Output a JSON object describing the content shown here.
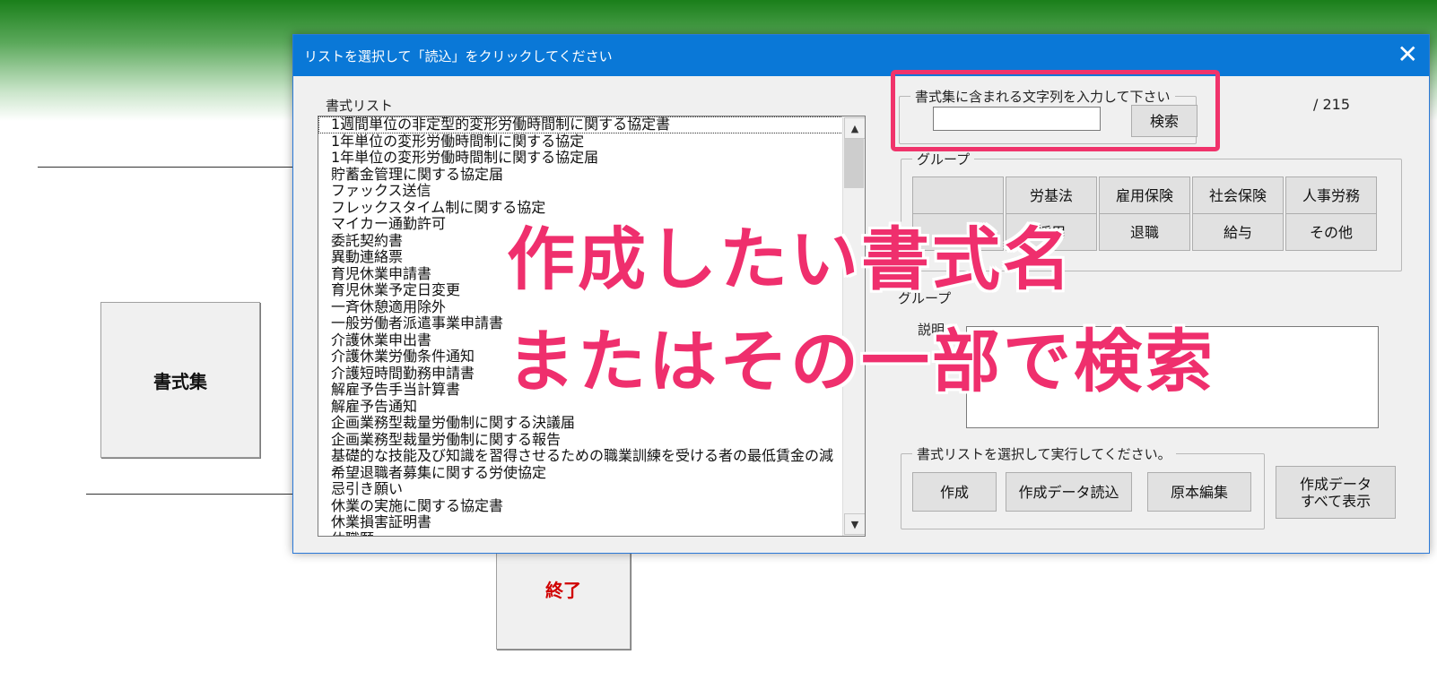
{
  "background": {
    "shosiki_button": "書式集",
    "exit_button": "終了"
  },
  "dialog": {
    "title": "リストを選択して「読込」をクリックしてください",
    "close_glyph": "✕",
    "list_label": "書式リスト",
    "list_items": [
      "1週間単位の非定型的変形労働時間制に関する協定書",
      "1年単位の変形労働時間制に関する協定",
      "1年単位の変形労働時間制に関する協定届",
      "貯蓄金管理に関する協定届",
      "ファックス送信",
      "フレックスタイム制に関する協定",
      "マイカー通勤許可",
      "委託契約書",
      "異動連絡票",
      "育児休業申請書",
      "育児休業予定日変更",
      "一斉休憩適用除外",
      "一般労働者派遣事業申請書",
      "介護休業申出書",
      "介護休業労働条件通知",
      "介護短時間勤務申請書",
      "解雇予告手当計算書",
      "解雇予告通知",
      "企画業務型裁量労働制に関する決議届",
      "企画業務型裁量労働制に関する報告",
      "基礎的な技能及び知識を習得させるための職業訓練を受ける者の最低賃金の減",
      "希望退職者募集に関する労使協定",
      "忌引き願い",
      "休業の実施に関する協定書",
      "休業損害証明書",
      "休職願"
    ],
    "search": {
      "group_title": "書式集に含まれる文字列を入力して下さい",
      "input_value": "",
      "button_label": "検索"
    },
    "count_text": "/ 215",
    "group": {
      "title": "グループ",
      "buttons_row1": [
        "",
        "労基法",
        "雇用保険",
        "社会保険",
        "人事労務"
      ],
      "buttons_row2": [
        "",
        "採用",
        "退職",
        "給与",
        "その他"
      ]
    },
    "group_label2": "グループ",
    "description_label": "説明",
    "actions": {
      "group_title": "書式リストを選択して実行してください。",
      "create": "作成",
      "load_data": "作成データ読込",
      "edit_original": "原本編集",
      "show_all": "作成データ すべて表示"
    }
  },
  "annotation": {
    "line1": "作成したい書式名",
    "line2": "またはその一部で検索",
    "color": "#ef2f6d",
    "highlight_color": "#f0336b"
  }
}
